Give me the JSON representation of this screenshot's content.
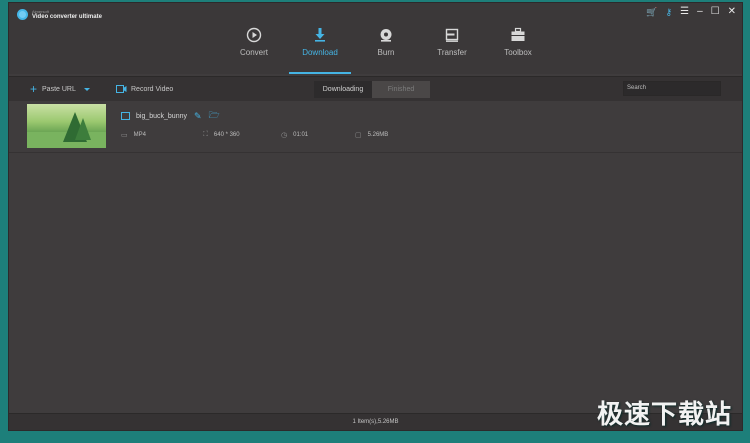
{
  "app": {
    "brand_small": "Aimersoft",
    "brand_main": "Video converter ultimate"
  },
  "window_controls": [
    "cart-icon",
    "key-icon",
    "menu-icon",
    "minimize-icon",
    "maximize-icon",
    "close-icon"
  ],
  "tabs": [
    {
      "label": "Convert",
      "icon": "convert-icon",
      "active": false
    },
    {
      "label": "Download",
      "icon": "download-icon",
      "active": true
    },
    {
      "label": "Burn",
      "icon": "burn-icon",
      "active": false
    },
    {
      "label": "Transfer",
      "icon": "transfer-icon",
      "active": false
    },
    {
      "label": "Toolbox",
      "icon": "toolbox-icon",
      "active": false
    }
  ],
  "toolbar": {
    "paste_url": "Paste URL",
    "record_video": "Record Video",
    "segments": [
      "Downloading",
      "Finished"
    ],
    "search_placeholder": "Search"
  },
  "item": {
    "filename": "big_buck_bunny",
    "format": "MP4",
    "resolution": "640 * 360",
    "duration": "01:01",
    "size": "5.26MB"
  },
  "status": "1 Item(s),5.26MB",
  "watermark": "极速下载站",
  "colors": {
    "accent": "#45b4e4",
    "background": "#3f3c3d",
    "frame": "#1d7f7a"
  }
}
